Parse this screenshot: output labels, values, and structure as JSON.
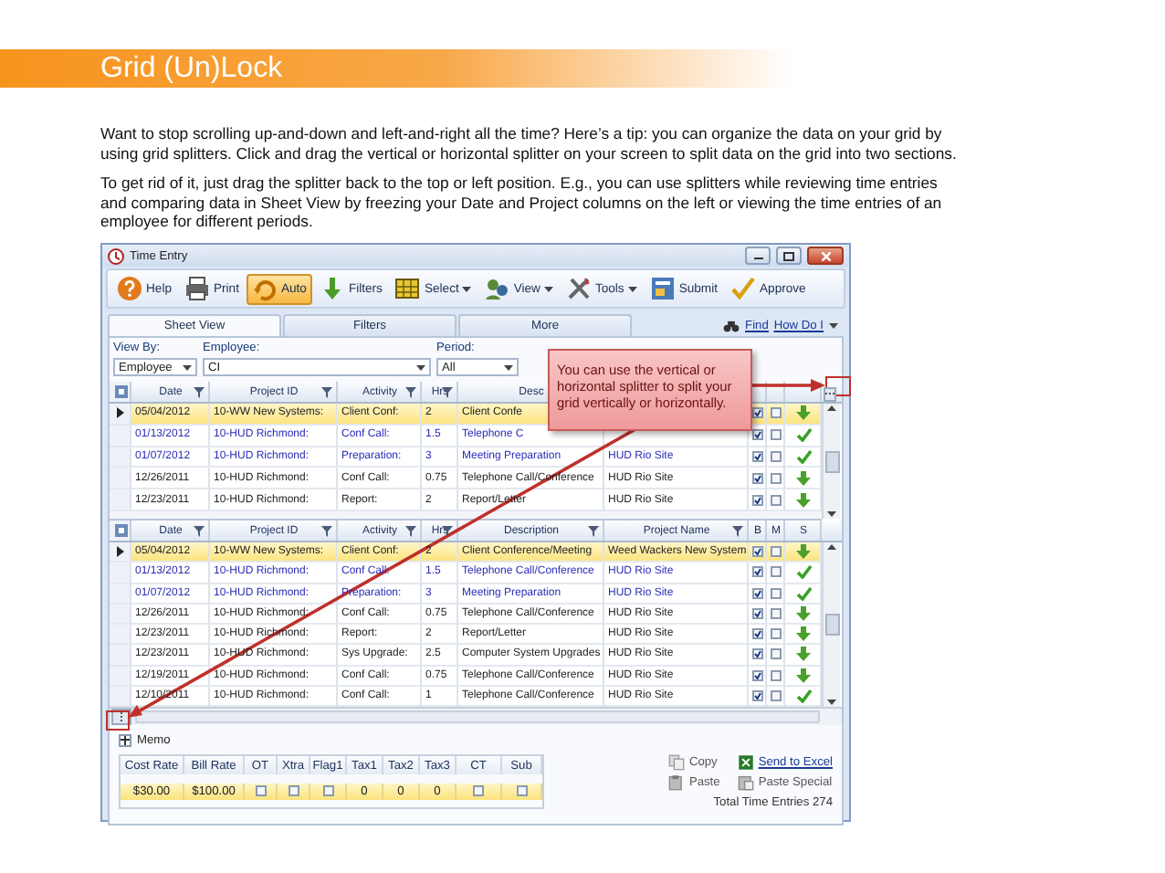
{
  "slide": {
    "title": "Grid (Un)Lock",
    "paragraphs": [
      "Want to stop scrolling up-and-down and left-and-right all the time? Here’s a tip: you can organize the data on your grid by using grid splitters. Click and drag the vertical or horizontal splitter on your screen to split data on the grid into two sections.",
      "To get rid of it, just drag the splitter back to the top or left position. E.g., you can use splitters while reviewing time entries and comparing data in Sheet View by freezing your Date and Project columns on the left or viewing the time entries of an employee for different periods."
    ]
  },
  "window": {
    "title": "Time Entry"
  },
  "toolbar": [
    {
      "label": "Help",
      "pressed": false,
      "dropdown": false
    },
    {
      "label": "Print",
      "pressed": false,
      "dropdown": false
    },
    {
      "label": "Auto",
      "pressed": true,
      "dropdown": false
    },
    {
      "label": "Filters",
      "pressed": false,
      "dropdown": false
    },
    {
      "label": "Select",
      "pressed": false,
      "dropdown": true
    },
    {
      "label": "View",
      "pressed": false,
      "dropdown": true
    },
    {
      "label": "Tools",
      "pressed": false,
      "dropdown": true
    },
    {
      "label": "Submit",
      "pressed": false,
      "dropdown": false
    },
    {
      "label": "Approve",
      "pressed": false,
      "dropdown": false
    }
  ],
  "tabs": [
    {
      "label": "Sheet View",
      "selected": true
    },
    {
      "label": "Filters",
      "selected": false
    },
    {
      "label": "More",
      "selected": false
    }
  ],
  "links": [
    {
      "label": "Find",
      "dropdown": false
    },
    {
      "label": "How Do I",
      "dropdown": true
    }
  ],
  "filters": [
    {
      "label": "View By:",
      "value": "Employee"
    },
    {
      "label": "Employee:",
      "value": "CI"
    },
    {
      "label": "Period:",
      "value": "All"
    }
  ],
  "top_grid": {
    "columns": [
      {
        "label": "Date",
        "filter": true
      },
      {
        "label": "Project ID",
        "filter": true
      },
      {
        "label": "Activity",
        "filter": true
      },
      {
        "label": "Hrs",
        "filter": true
      },
      {
        "label": "Desc"
      }
    ],
    "rows": [
      {
        "cells": [
          "05/04/2012",
          "10-WW New Systems:",
          "Client Conf:",
          "2",
          "Client Confe"
        ],
        "selected": true,
        "color": "#222222",
        "b": true,
        "m": false,
        "kind": "submitted"
      },
      {
        "cells": [
          "01/13/2012",
          "10-HUD Richmond:",
          "Conf Call:",
          "1.5",
          "Telephone C"
        ],
        "selected": false,
        "color": "#2b2bb8",
        "b": true,
        "m": false,
        "kind": "approved"
      },
      {
        "cells": [
          "01/07/2012",
          "10-HUD Richmond:",
          "Preparation:",
          "3",
          "Meeting Preparation",
          "HUD Rio Site"
        ],
        "selected": false,
        "color": "#2b2bb8",
        "b": true,
        "m": false,
        "kind": "approved"
      },
      {
        "cells": [
          "12/26/2011",
          "10-HUD Richmond:",
          "Conf Call:",
          "0.75",
          "Telephone Call/Conference",
          "HUD Rio Site"
        ],
        "selected": false,
        "color": "#222222",
        "b": true,
        "m": false,
        "kind": "submitted"
      },
      {
        "cells": [
          "12/23/2011",
          "10-HUD Richmond:",
          "Report:",
          "2",
          "Report/Letter",
          "HUD Rio Site"
        ],
        "selected": false,
        "color": "#222222",
        "b": true,
        "m": false,
        "kind": "submitted"
      }
    ]
  },
  "bottom_grid": {
    "columns": [
      {
        "label": "Date",
        "filter": true
      },
      {
        "label": "Project ID",
        "filter": true
      },
      {
        "label": "Activity",
        "filter": true
      },
      {
        "label": "Hrs",
        "filter": true
      },
      {
        "label": "Description",
        "filter": true
      },
      {
        "label": "Project Name",
        "filter": true
      },
      {
        "label": "B",
        "filter": false
      },
      {
        "label": "M",
        "filter": false
      },
      {
        "label": "S",
        "filter": false
      }
    ],
    "rows": [
      {
        "cells": [
          "05/04/2012",
          "10-WW New Systems:",
          "Client Conf:",
          "2",
          "Client Conference/Meeting",
          "Weed Wackers New System"
        ],
        "selected": true,
        "color": "#222222",
        "b": true,
        "m": false,
        "kind": "submitted"
      },
      {
        "cells": [
          "01/13/2012",
          "10-HUD Richmond:",
          "Conf Call:",
          "1.5",
          "Telephone Call/Conference",
          "HUD Rio Site"
        ],
        "selected": false,
        "color": "#2b2bb8",
        "b": true,
        "m": false,
        "kind": "approved"
      },
      {
        "cells": [
          "01/07/2012",
          "10-HUD Richmond:",
          "Preparation:",
          "3",
          "Meeting Preparation",
          "HUD Rio Site"
        ],
        "selected": false,
        "color": "#2b2bb8",
        "b": true,
        "m": false,
        "kind": "approved"
      },
      {
        "cells": [
          "12/26/2011",
          "10-HUD Richmond:",
          "Conf Call:",
          "0.75",
          "Telephone Call/Conference",
          "HUD Rio Site"
        ],
        "selected": false,
        "color": "#222222",
        "b": true,
        "m": false,
        "kind": "submitted"
      },
      {
        "cells": [
          "12/23/2011",
          "10-HUD Richmond:",
          "Report:",
          "2",
          "Report/Letter",
          "HUD Rio Site"
        ],
        "selected": false,
        "color": "#222222",
        "b": true,
        "m": false,
        "kind": "submitted"
      },
      {
        "cells": [
          "12/23/2011",
          "10-HUD Richmond:",
          "Sys Upgrade:",
          "2.5",
          "Computer System Upgrades",
          "HUD Rio Site"
        ],
        "selected": false,
        "color": "#222222",
        "b": true,
        "m": false,
        "kind": "submitted"
      },
      {
        "cells": [
          "12/19/2011",
          "10-HUD Richmond:",
          "Conf Call:",
          "0.75",
          "Telephone Call/Conference",
          "HUD Rio Site"
        ],
        "selected": false,
        "color": "#222222",
        "b": true,
        "m": false,
        "kind": "submitted"
      },
      {
        "cells": [
          "12/10/2011",
          "10-HUD Richmond:",
          "Conf Call:",
          "1",
          "Telephone Call/Conference",
          "HUD Rio Site"
        ],
        "selected": false,
        "color": "#222222",
        "b": true,
        "m": false,
        "kind": "approved"
      }
    ]
  },
  "callout": {
    "text": "You can use the vertical or horizontal splitter to split your grid vertically or horizontally."
  },
  "memo": {
    "label": "Memo"
  },
  "rates": {
    "columns": [
      "Cost Rate",
      "Bill Rate",
      "OT",
      "Xtra",
      "Flag1",
      "Tax1",
      "Tax2",
      "Tax3",
      "CT",
      "Sub"
    ],
    "values": [
      {
        "kind": "text",
        "text": "$30.00"
      },
      {
        "kind": "text",
        "text": "$100.00"
      },
      {
        "kind": "checkbox",
        "checked": false
      },
      {
        "kind": "checkbox",
        "checked": false
      },
      {
        "kind": "checkbox",
        "checked": false
      },
      {
        "kind": "text",
        "text": "0"
      },
      {
        "kind": "text",
        "text": "0"
      },
      {
        "kind": "text",
        "text": "0"
      },
      {
        "kind": "checkbox",
        "checked": false
      },
      {
        "kind": "checkbox",
        "checked": false
      }
    ]
  },
  "actions": [
    {
      "label": "Copy",
      "link": false
    },
    {
      "label": "Send to Excel",
      "link": true
    },
    {
      "label": "Paste",
      "link": false
    },
    {
      "label": "Paste Special",
      "link": false
    }
  ],
  "status": "Total Time Entries 274"
}
